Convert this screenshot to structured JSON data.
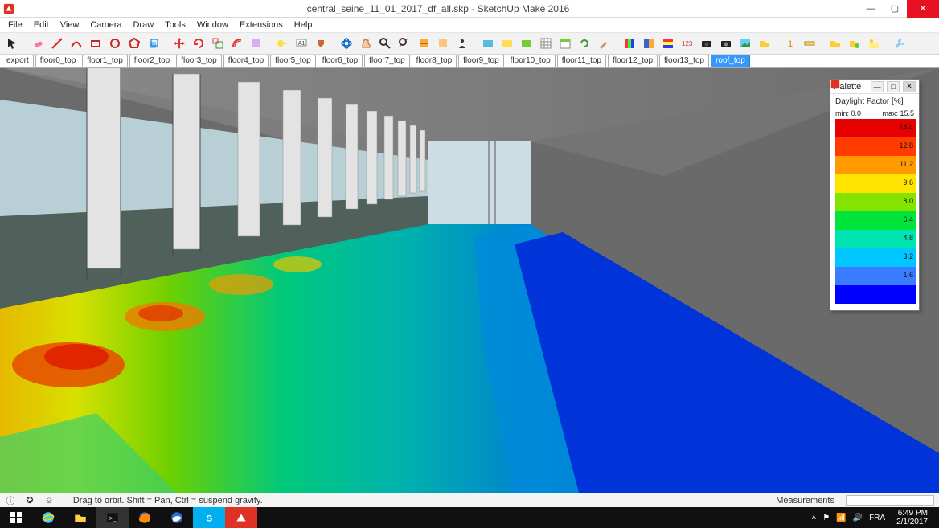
{
  "titlebar": {
    "title": "central_seine_11_01_2017_df_all.skp - SketchUp Make 2016"
  },
  "menu": [
    "File",
    "Edit",
    "View",
    "Camera",
    "Draw",
    "Tools",
    "Window",
    "Extensions",
    "Help"
  ],
  "scenes": {
    "items": [
      "export",
      "floor0_top",
      "floor1_top",
      "floor2_top",
      "floor3_top",
      "floor4_top",
      "floor5_top",
      "floor6_top",
      "floor7_top",
      "floor8_top",
      "floor9_top",
      "floor10_top",
      "floor11_top",
      "floor12_top",
      "floor13_top",
      "roof_top"
    ],
    "active_index": 15
  },
  "palette": {
    "title": "Palette",
    "label": "Daylight Factor [%]",
    "min_label": "min: 0.0",
    "max_label": "max: 15.5",
    "ramp": [
      {
        "color": "#e60000",
        "value": "14.4"
      },
      {
        "color": "#ff3b00",
        "value": "12.8"
      },
      {
        "color": "#ff9a00",
        "value": "11.2"
      },
      {
        "color": "#ffe400",
        "value": "9.6"
      },
      {
        "color": "#84e400",
        "value": "8.0"
      },
      {
        "color": "#00e43b",
        "value": "6.4"
      },
      {
        "color": "#00e4b0",
        "value": "4.8"
      },
      {
        "color": "#00c7ff",
        "value": "3.2"
      },
      {
        "color": "#3b7bff",
        "value": "1.6"
      },
      {
        "color": "#0000ff",
        "value": ""
      }
    ]
  },
  "status": {
    "hint": "Drag to orbit. Shift = Pan, Ctrl = suspend gravity.",
    "measurements_label": "Measurements"
  },
  "taskbar": {
    "lang": "FRA",
    "time": "6:49 PM",
    "date": "2/1/2017"
  },
  "chart_data": {
    "type": "table",
    "title": "Daylight Factor [%]",
    "min": 0.0,
    "max": 15.5,
    "thresholds": [
      1.6,
      3.2,
      4.8,
      6.4,
      8.0,
      9.6,
      11.2,
      12.8,
      14.4
    ],
    "colors_low_to_high": [
      "#0000ff",
      "#3b7bff",
      "#00c7ff",
      "#00e4b0",
      "#00e43b",
      "#84e400",
      "#ffe400",
      "#ff9a00",
      "#ff3b00",
      "#e60000"
    ]
  }
}
